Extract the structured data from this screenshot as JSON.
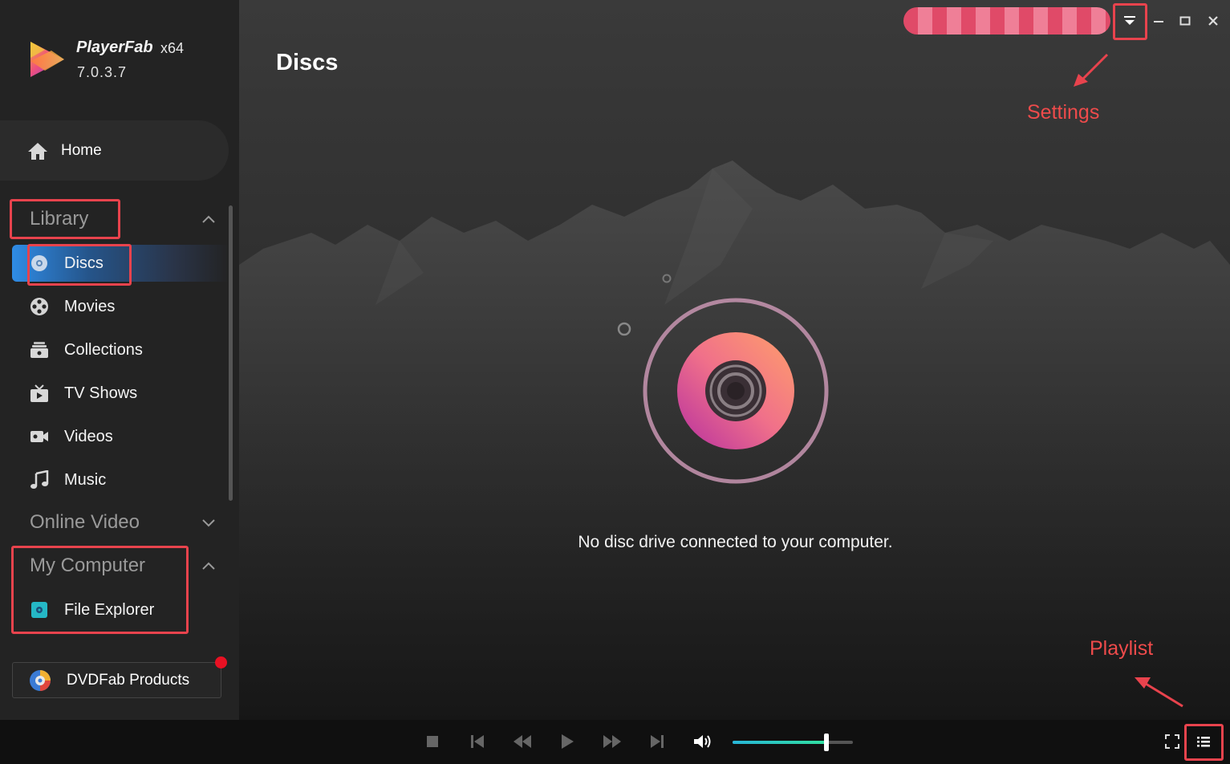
{
  "app": {
    "name": "PlayerFab",
    "arch": "x64",
    "version": "7.0.3.7"
  },
  "page": {
    "title": "Discs",
    "empty_message": "No disc drive connected to your computer."
  },
  "sidebar": {
    "home_label": "Home",
    "library": {
      "title": "Library",
      "items": [
        {
          "label": "Discs",
          "icon": "disc-icon",
          "active": true
        },
        {
          "label": "Movies",
          "icon": "film-reel-icon"
        },
        {
          "label": "Collections",
          "icon": "collections-icon"
        },
        {
          "label": "TV Shows",
          "icon": "tv-icon"
        },
        {
          "label": "Videos",
          "icon": "video-camera-icon"
        },
        {
          "label": "Music",
          "icon": "music-note-icon"
        }
      ]
    },
    "online_video": {
      "title": "Online Video"
    },
    "my_computer": {
      "title": "My Computer",
      "items": [
        {
          "label": "File Explorer",
          "icon": "file-explorer-icon"
        }
      ]
    },
    "products_label": "DVDFab Products"
  },
  "annotations": {
    "settings": "Settings",
    "playlist": "Playlist"
  },
  "player": {
    "volume": 0.78
  },
  "colors": {
    "accent": "#2f8ce6",
    "annotation": "#e8434d",
    "disc_gradient_start": "#ff9a6c",
    "disc_gradient_end": "#c2368f"
  }
}
